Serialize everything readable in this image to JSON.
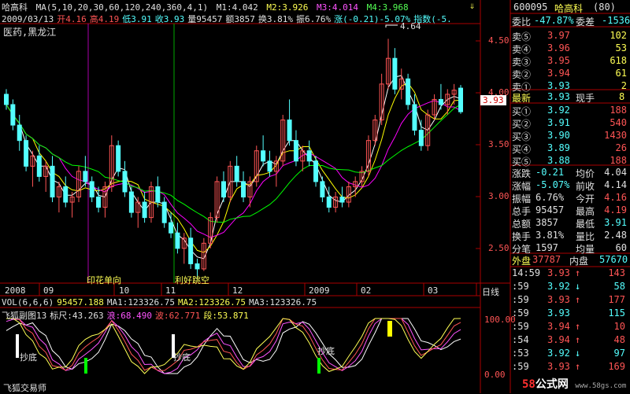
{
  "header": {
    "stock_name": "哈高科",
    "ma_label": "MA(5,10,20,30,60,120,240,360,4,1)",
    "m1": "M1:4.042",
    "m2": "M2:3.926",
    "m3": "M3:4.014",
    "m4": "M4:3.968",
    "date": "2009/03/13",
    "open": "开4.16",
    "high": "高4.19",
    "low": "低3.91",
    "close": "收3.93",
    "volume": "量95457",
    "amount": "额3857",
    "turnover": "换3.81%",
    "amplitude": "振6.76%",
    "change": "涨(-0.21)-5.07%",
    "index": "指数(-5.",
    "sector": "医药,黑龙江"
  },
  "right_panel": {
    "code": "600095",
    "name": "哈高科",
    "rank": "(80)",
    "weibi_label": "委比",
    "weibi": "-47.87%",
    "weicha_label": "委差",
    "weicha": "-1536",
    "asks": [
      {
        "label": "卖⑤",
        "price": "3.97",
        "vol": "102"
      },
      {
        "label": "卖④",
        "price": "3.96",
        "vol": "53"
      },
      {
        "label": "卖③",
        "price": "3.95",
        "vol": "618"
      },
      {
        "label": "卖②",
        "price": "3.94",
        "vol": "61"
      },
      {
        "label": "卖①",
        "price": "3.93",
        "vol": "2"
      }
    ],
    "last_label": "最新",
    "last": "3.93",
    "xianshou_label": "现手",
    "xianshou": "8",
    "bids": [
      {
        "label": "买①",
        "price": "3.92",
        "vol": "188"
      },
      {
        "label": "买②",
        "price": "3.91",
        "vol": "540"
      },
      {
        "label": "买③",
        "price": "3.90",
        "vol": "1430"
      },
      {
        "label": "买④",
        "price": "3.89",
        "vol": "26"
      },
      {
        "label": "买⑤",
        "price": "3.88",
        "vol": "188"
      }
    ],
    "stats": [
      {
        "l1": "涨跌",
        "v1": "-0.21",
        "l2": "均价",
        "v2": "4.04"
      },
      {
        "l1": "涨幅",
        "v1": "-5.07%",
        "l2": "前收",
        "v2": "4.14"
      },
      {
        "l1": "振幅",
        "v1": "6.76%",
        "l2": "今开",
        "v2": "4.16"
      },
      {
        "l1": "总手",
        "v1": "95457",
        "l2": "最高",
        "v2": "4.19"
      },
      {
        "l1": "总额",
        "v1": "3857",
        "l2": "最低",
        "v2": "3.91"
      },
      {
        "l1": "换手",
        "v1": "3.81%",
        "l2": "量比",
        "v2": "2.48"
      },
      {
        "l1": "分笔",
        "v1": "1597",
        "l2": "均量",
        "v2": "60"
      }
    ],
    "waipan_label": "外盘",
    "waipan": "37787",
    "neipan_label": "内盘",
    "neipan": "57670",
    "ticks": [
      {
        "time": "14:59",
        "price": "3.93",
        "arrow": "↑",
        "vol": "143"
      },
      {
        "time": ":59",
        "price": "3.92",
        "arrow": "↓",
        "vol": "58"
      },
      {
        "time": ":59",
        "price": "3.93",
        "arrow": "↑",
        "vol": "177"
      },
      {
        "time": ":59",
        "price": "3.93",
        "arrow": "",
        "vol": "115"
      },
      {
        "time": ":59",
        "price": "3.94",
        "arrow": "↑",
        "vol": "10"
      },
      {
        "time": ":54",
        "price": "3.94",
        "arrow": "↑",
        "vol": "48"
      },
      {
        "time": ":53",
        "price": "3.92",
        "arrow": "↓",
        "vol": "97"
      },
      {
        "time": ":59",
        "price": "3.93",
        "arrow": "↑",
        "vol": "169"
      }
    ]
  },
  "main_chart": {
    "y_ticks": [
      "4.50",
      "4.00",
      "3.50",
      "3.00",
      "2.50"
    ],
    "current_price_tag": "3.93",
    "max_label": "4.64",
    "annotations": [
      "印花单向",
      "利好跳空"
    ]
  },
  "x_axis": {
    "labels": [
      "2008",
      "09",
      "10",
      "11",
      "12",
      "2009",
      "02",
      "03"
    ],
    "period": "日线"
  },
  "vol_bar": {
    "name": "VOL(6,6,6)",
    "vol": "95457.188",
    "ma1": "MA1:123326.75",
    "ma2": "MA2:123326.75",
    "ma3": "MA3:123326.75"
  },
  "indicator": {
    "name": "飞狐副图13",
    "biaochi": "标尺:43.263",
    "lang": "浪:68.490",
    "bo": "波:62.771",
    "duan": "段:53.871",
    "y_ticks": [
      "100.00",
      "0.00"
    ],
    "bottom_labels": [
      "抄底",
      "抄底",
      "抄底"
    ],
    "footer": "飞狐交易师"
  },
  "colors": {
    "up": "#ff5555",
    "down": "#54ffff",
    "ma5": "#ffffff",
    "ma10": "#ffff00",
    "ma20": "#ff00ff",
    "ma30": "#00ff00",
    "frame": "#aa0000"
  },
  "chart_data": {
    "type": "candlestick",
    "symbol": "600095",
    "y_range": [
      2.3,
      4.75
    ],
    "ohlc_approx": [
      [
        4.1,
        4.15,
        3.95,
        4.0
      ],
      [
        4.0,
        4.05,
        3.75,
        3.8
      ],
      [
        3.8,
        3.9,
        3.55,
        3.65
      ],
      [
        3.65,
        3.7,
        3.35,
        3.4
      ],
      [
        3.4,
        3.55,
        3.2,
        3.5
      ],
      [
        3.5,
        3.6,
        3.25,
        3.3
      ],
      [
        3.3,
        3.45,
        3.15,
        3.4
      ],
      [
        3.4,
        3.5,
        3.05,
        3.1
      ],
      [
        3.1,
        3.25,
        2.95,
        3.2
      ],
      [
        3.2,
        3.3,
        3.0,
        3.05
      ],
      [
        3.05,
        3.15,
        2.9,
        3.1
      ],
      [
        3.1,
        3.4,
        3.05,
        3.35
      ],
      [
        3.35,
        3.5,
        3.2,
        3.25
      ],
      [
        3.25,
        3.3,
        3.05,
        3.1
      ],
      [
        3.1,
        3.2,
        2.95,
        3.0
      ],
      [
        3.0,
        3.25,
        2.9,
        3.2
      ],
      [
        3.2,
        3.7,
        3.15,
        3.6
      ],
      [
        3.6,
        3.65,
        3.3,
        3.35
      ],
      [
        3.35,
        3.45,
        3.1,
        3.15
      ],
      [
        3.15,
        3.2,
        2.9,
        2.95
      ],
      [
        2.95,
        3.1,
        2.8,
        3.05
      ],
      [
        3.05,
        3.15,
        2.85,
        2.9
      ],
      [
        2.9,
        3.25,
        2.85,
        3.2
      ],
      [
        3.2,
        3.3,
        3.0,
        3.05
      ],
      [
        3.05,
        3.1,
        2.8,
        2.85
      ],
      [
        2.85,
        2.95,
        2.7,
        2.75
      ],
      [
        2.75,
        2.85,
        2.55,
        2.6
      ],
      [
        2.6,
        2.75,
        2.45,
        2.7
      ],
      [
        2.7,
        2.8,
        2.4,
        2.45
      ],
      [
        2.45,
        2.5,
        2.3,
        2.4
      ],
      [
        2.4,
        2.7,
        2.38,
        2.65
      ],
      [
        2.65,
        2.95,
        2.6,
        2.9
      ],
      [
        2.9,
        3.3,
        2.85,
        3.25
      ],
      [
        3.25,
        3.35,
        3.05,
        3.1
      ],
      [
        3.1,
        3.45,
        3.05,
        3.4
      ],
      [
        3.4,
        3.5,
        3.2,
        3.25
      ],
      [
        3.25,
        3.35,
        3.05,
        3.1
      ],
      [
        3.1,
        3.3,
        3.0,
        3.25
      ],
      [
        3.25,
        3.6,
        3.2,
        3.55
      ],
      [
        3.55,
        3.7,
        3.4,
        3.45
      ],
      [
        3.45,
        3.55,
        3.3,
        3.35
      ],
      [
        3.35,
        3.5,
        3.2,
        3.45
      ],
      [
        3.45,
        3.9,
        3.4,
        3.85
      ],
      [
        3.85,
        4.05,
        3.6,
        3.65
      ],
      [
        3.65,
        3.75,
        3.4,
        3.45
      ],
      [
        3.45,
        3.6,
        3.35,
        3.55
      ],
      [
        3.55,
        3.65,
        3.4,
        3.45
      ],
      [
        3.45,
        3.5,
        3.2,
        3.25
      ],
      [
        3.25,
        3.3,
        3.05,
        3.1
      ],
      [
        3.1,
        3.2,
        2.95,
        3.0
      ],
      [
        3.0,
        3.15,
        2.95,
        3.1
      ],
      [
        3.1,
        3.2,
        3.0,
        3.05
      ],
      [
        3.05,
        3.25,
        3.0,
        3.2
      ],
      [
        3.2,
        3.3,
        3.1,
        3.25
      ],
      [
        3.25,
        3.4,
        3.2,
        3.35
      ],
      [
        3.35,
        3.7,
        3.3,
        3.65
      ],
      [
        3.65,
        3.9,
        3.6,
        3.85
      ],
      [
        3.85,
        4.3,
        3.8,
        4.2
      ],
      [
        4.2,
        4.64,
        4.15,
        4.45
      ],
      [
        4.45,
        4.55,
        4.1,
        4.15
      ],
      [
        4.15,
        4.35,
        4.05,
        4.25
      ],
      [
        4.25,
        4.3,
        3.95,
        4.0
      ],
      [
        4.0,
        4.1,
        3.7,
        3.75
      ],
      [
        3.75,
        3.85,
        3.55,
        3.6
      ],
      [
        3.6,
        3.95,
        3.55,
        3.9
      ],
      [
        3.9,
        4.1,
        3.85,
        4.05
      ],
      [
        4.05,
        4.2,
        3.95,
        4.0
      ],
      [
        4.0,
        4.15,
        3.9,
        4.1
      ],
      [
        4.1,
        4.2,
        4.0,
        4.14
      ],
      [
        4.16,
        4.19,
        3.91,
        3.93
      ]
    ]
  }
}
